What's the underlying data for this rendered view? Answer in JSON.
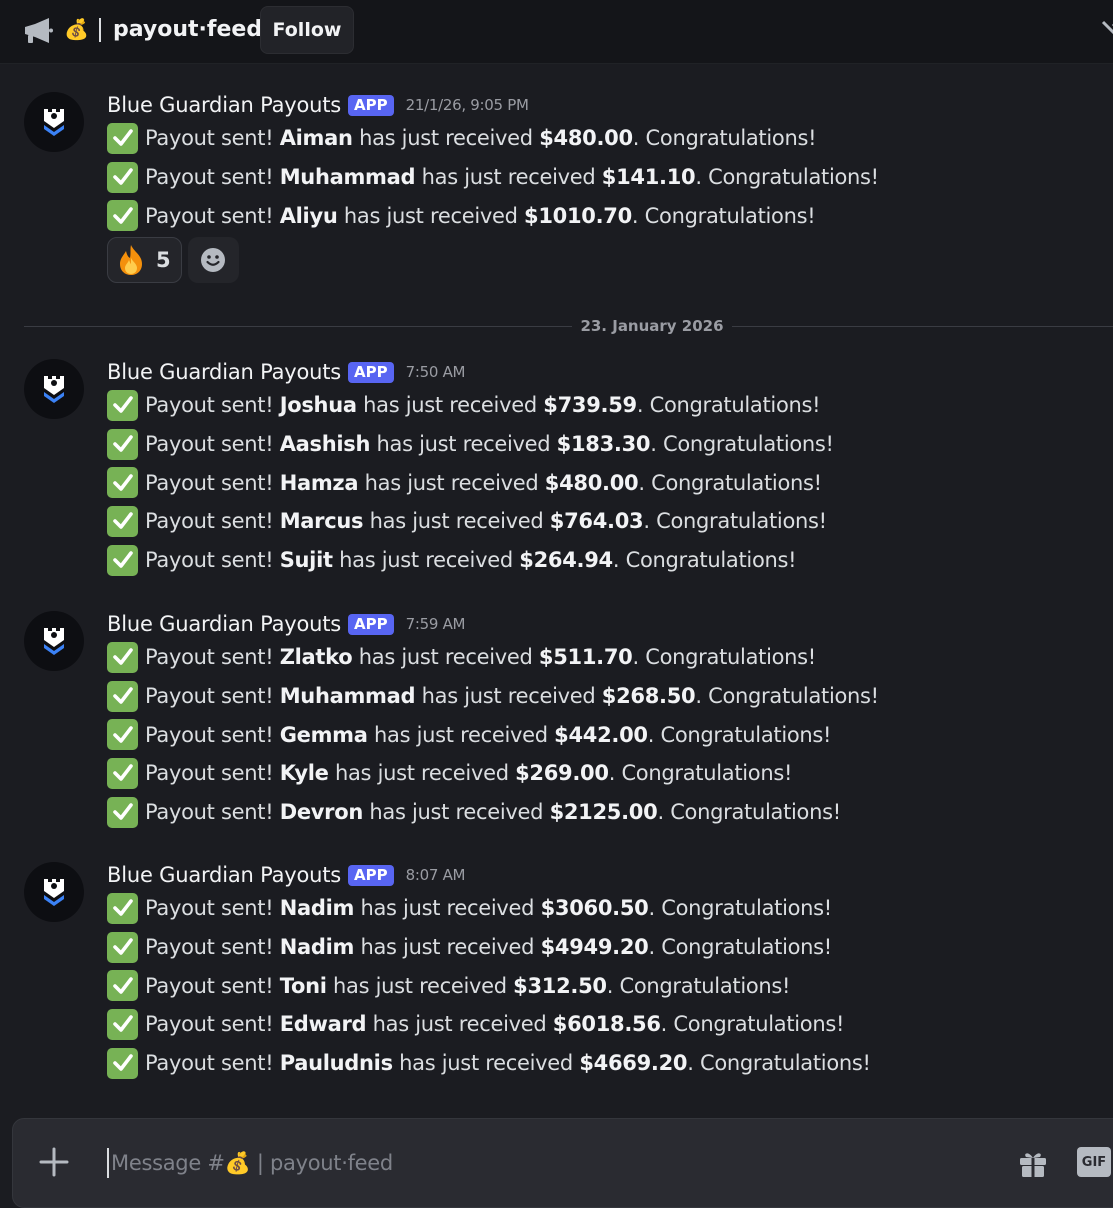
{
  "channel": {
    "emoji": "💰",
    "name": "payout·feed",
    "follow_label": "Follow"
  },
  "groups": [
    {
      "author": "Blue Guardian Payouts",
      "badge": "APP",
      "time": "21/1/26, 9:05 PM",
      "lines": [
        {
          "name": "Aiman",
          "amount": "$480.00"
        },
        {
          "name": "Muhammad",
          "amount": "$141.10"
        },
        {
          "name": "Aliyu",
          "amount": "$1010.70"
        }
      ]
    },
    {
      "author": "Blue Guardian Payouts",
      "badge": "APP",
      "time": "7:50 AM",
      "lines": [
        {
          "name": "Joshua",
          "amount": "$739.59"
        },
        {
          "name": "Aashish",
          "amount": "$183.30"
        },
        {
          "name": "Hamza",
          "amount": "$480.00"
        },
        {
          "name": "Marcus",
          "amount": "$764.03"
        },
        {
          "name": "Sujit",
          "amount": "$264.94"
        }
      ]
    },
    {
      "author": "Blue Guardian Payouts",
      "badge": "APP",
      "time": "7:59 AM",
      "lines": [
        {
          "name": "Zlatko",
          "amount": "$511.70"
        },
        {
          "name": "Muhammad",
          "amount": "$268.50"
        },
        {
          "name": "Gemma",
          "amount": "$442.00"
        },
        {
          "name": "Kyle",
          "amount": "$269.00"
        },
        {
          "name": "Devron",
          "amount": "$2125.00"
        }
      ]
    },
    {
      "author": "Blue Guardian Payouts",
      "badge": "APP",
      "time": "8:07 AM",
      "lines": [
        {
          "name": "Nadim",
          "amount": "$3060.50"
        },
        {
          "name": "Nadim",
          "amount": "$4949.20"
        },
        {
          "name": "Toni",
          "amount": "$312.50"
        },
        {
          "name": "Edward",
          "amount": "$6018.56"
        },
        {
          "name": "Pauludnis",
          "amount": "$4669.20"
        }
      ]
    }
  ],
  "text": {
    "prefix": "Payout sent!",
    "middle": "has just received",
    "suffix": ". Congratulations!"
  },
  "reactions": [
    {
      "emoji": "fire",
      "count": "5"
    }
  ],
  "divider": {
    "date": "23. January 2026"
  },
  "composer": {
    "placeholder": "Message #💰 | payout·feed",
    "gif_label": "GIF"
  },
  "icons": {
    "header_channel": "megaphone-icon",
    "add": "plus-icon",
    "gift": "gift-icon",
    "emoji_picker": "smiley-icon",
    "check": "white-check-mark-icon"
  },
  "colors": {
    "background": "#1b1c21",
    "header": "#141519",
    "app_badge": "#5865f2",
    "check": "#77b255"
  }
}
